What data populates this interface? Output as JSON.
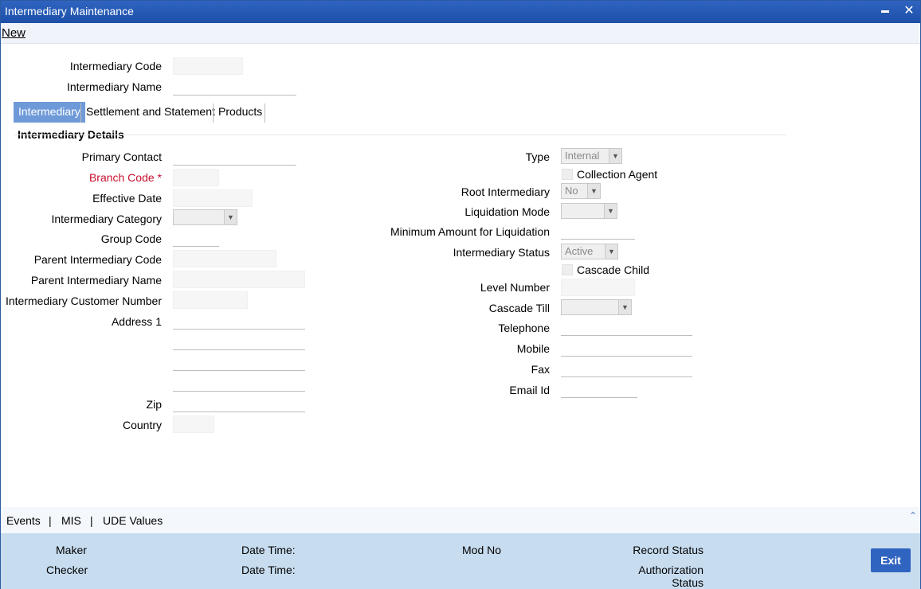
{
  "window": {
    "title": "Intermediary Maintenance",
    "minimize_glyph": "▬",
    "close_glyph": "✕"
  },
  "menu": {
    "new_label": "New"
  },
  "header": {
    "code_label": "Intermediary Code",
    "name_label": "Intermediary Name"
  },
  "tabs": [
    {
      "label": "Intermediary",
      "active": true
    },
    {
      "label": "Settlement and Statement",
      "active": false
    },
    {
      "label": "Products",
      "active": false
    }
  ],
  "section": {
    "title": "Intermediary Details"
  },
  "left": {
    "primary_contact": "Primary Contact",
    "branch_code": "Branch Code",
    "required_mark": "*",
    "effective_date": "Effective Date",
    "category": "Intermediary Category",
    "group_code": "Group Code",
    "parent_code": "Parent Intermediary Code",
    "parent_name": "Parent Intermediary Name",
    "customer_number": "Intermediary Customer Number",
    "address1": "Address 1",
    "zip": "Zip",
    "country": "Country"
  },
  "right": {
    "type_label": "Type",
    "type_value": "Internal",
    "collection_agent": "Collection Agent",
    "root_label": "Root Intermediary",
    "root_value": "No",
    "liquidation_mode": "Liquidation Mode",
    "min_amount": "Minimum Amount for Liquidation",
    "status_label": "Intermediary Status",
    "status_value": "Active",
    "cascade_child": "Cascade Child",
    "level_number": "Level Number",
    "cascade_till": "Cascade Till",
    "telephone": "Telephone",
    "mobile": "Mobile",
    "fax": "Fax",
    "email": "Email Id"
  },
  "bottom_links": {
    "events": "Events",
    "mis": "MIS",
    "ude": "UDE Values",
    "separator": "|",
    "collapse_glyph": "⌃"
  },
  "footer": {
    "maker": "Maker",
    "checker": "Checker",
    "date_time_1": "Date Time:",
    "date_time_2": "Date Time:",
    "mod_no": "Mod No",
    "record_status": "Record Status",
    "auth_status_line1": "Authorization",
    "auth_status_line2": "Status",
    "exit_label": "Exit"
  },
  "dropdown_arrow_glyph": "▼",
  "colors": {
    "title_bar": "#2f64c0",
    "active_tab": "#6f9ad9",
    "required": "#c8102e",
    "footer": "#c7dcef",
    "exit_button": "#2f64c0"
  }
}
